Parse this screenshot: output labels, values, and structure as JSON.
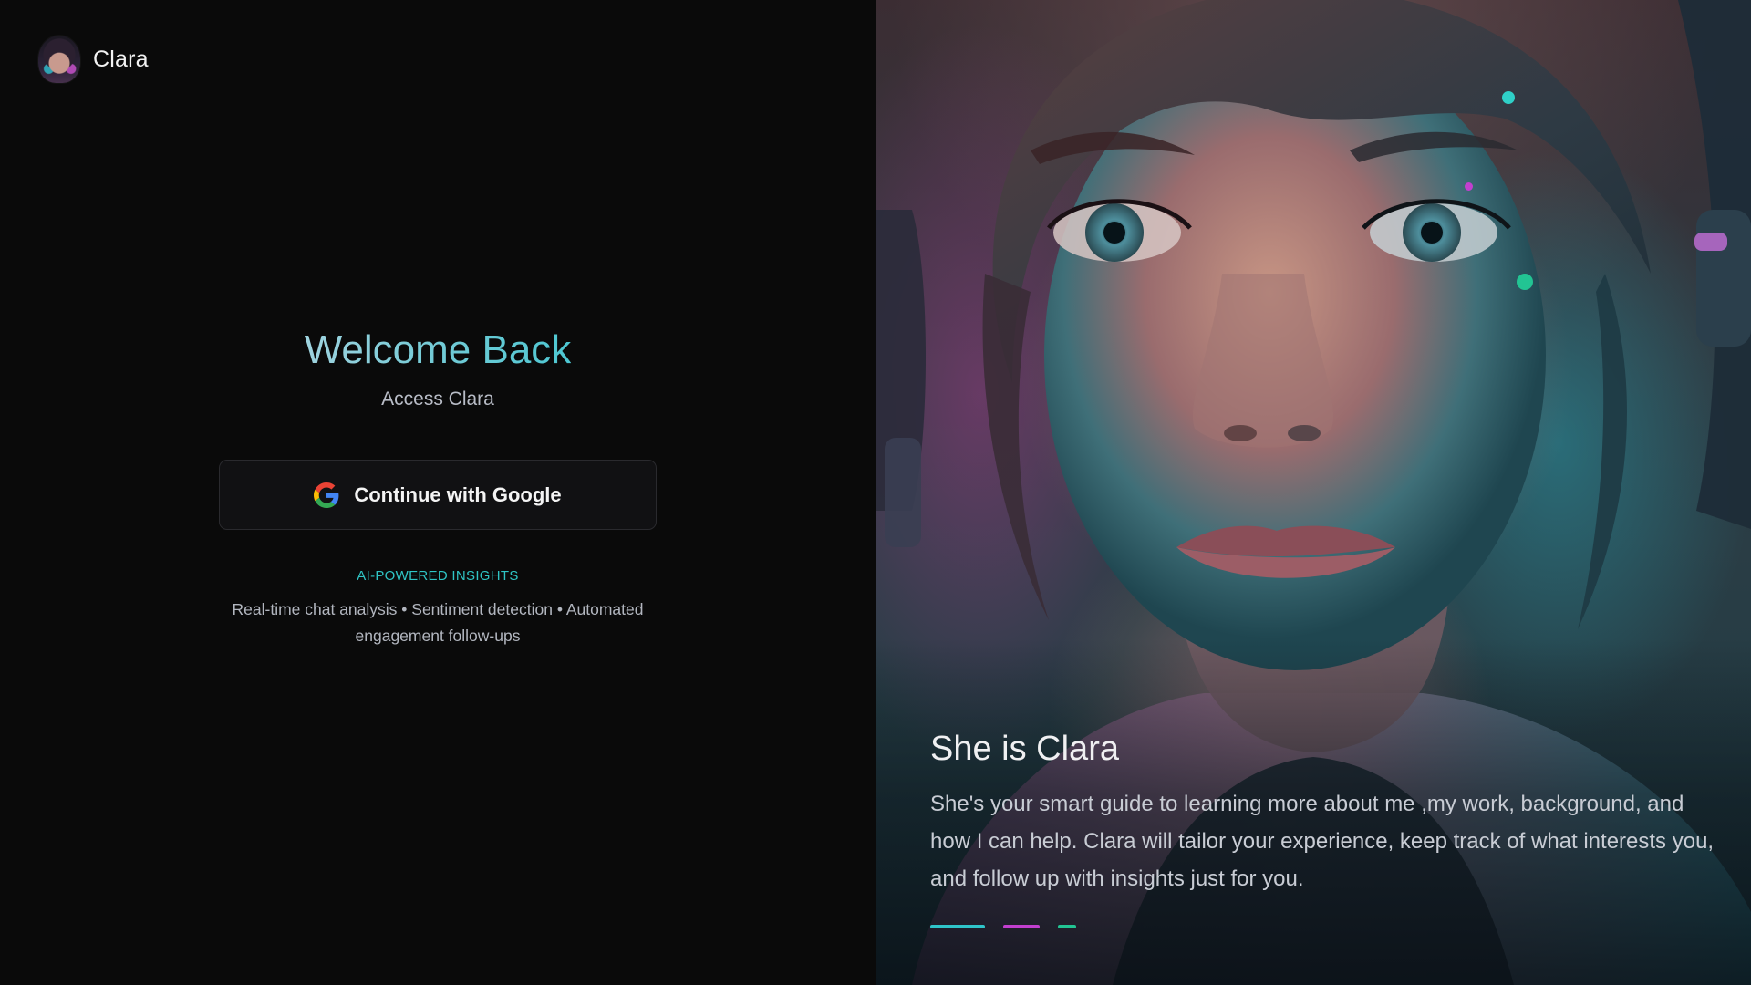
{
  "brand": {
    "name": "Clara",
    "avatar_icon": "clara-avatar-icon"
  },
  "login": {
    "title": "Welcome Back",
    "subtitle": "Access Clara",
    "google_button_label": "Continue with Google",
    "google_icon": "google-g-icon",
    "insights_title": "AI-POWERED INSIGHTS",
    "insights_text": "Real-time chat analysis • Sentiment detection • Automated engagement follow-ups"
  },
  "hero": {
    "title": "She is Clara",
    "description": "She's your smart guide to learning more about me ,my work, background, and how I can help. Clara will tailor your experience, keep track of what interests you, and follow up with insights just for you.",
    "indicators": [
      {
        "name": "slide-1",
        "color": "#2fc4c9",
        "active": true
      },
      {
        "name": "slide-2",
        "color": "#c23fcf",
        "active": false
      },
      {
        "name": "slide-3",
        "color": "#22c493",
        "active": false
      }
    ]
  },
  "colors": {
    "accent_cyan": "#2fc4c4",
    "accent_magenta": "#c23fcf",
    "accent_green": "#22c493",
    "background": "#0a0a0a"
  }
}
